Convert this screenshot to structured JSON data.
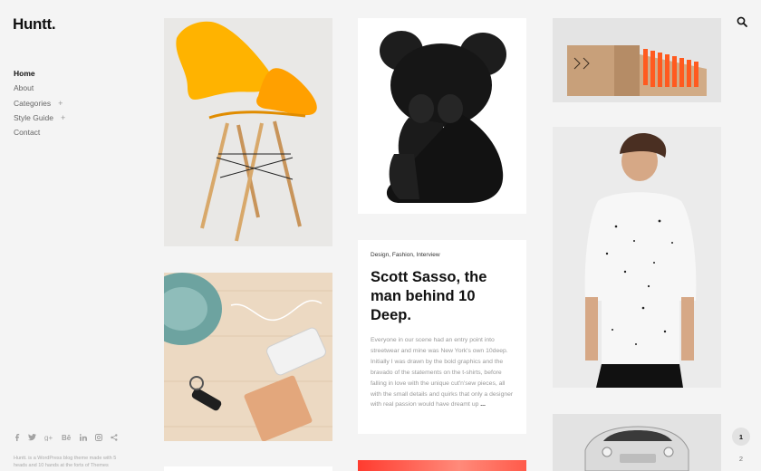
{
  "brand": {
    "logo": "Huntt."
  },
  "nav": {
    "items": [
      {
        "label": "Home"
      },
      {
        "label": "About"
      },
      {
        "label": "Categories",
        "expand": "+"
      },
      {
        "label": "Style Guide",
        "expand": "+"
      },
      {
        "label": "Contact"
      }
    ]
  },
  "social": [
    "f",
    "t",
    "g+",
    "Bē",
    "in",
    "ig",
    "share"
  ],
  "footer": {
    "text": "Huntt. is a WordPress blog theme made with 5 heads and 10 hands at the forts of Themes"
  },
  "post": {
    "categories": "Design, Fashion, Interview",
    "title": "Scott Sasso, the man behind 10 Deep.",
    "excerpt": "Everyone in our scene had an entry point into streetwear and mine was New York's own 10deep. Initially I was drawn by the bold graphics and the bravado of the statements on the t-shirts, before falling in love with the unique cut'n'sew pieces, all with the small details and quirks that only a designer with real passion would have dreamt up",
    "more": "..."
  },
  "pagination": {
    "current": "1",
    "next": "2"
  },
  "colors": {
    "background": "#f4f4f4",
    "card": "#ffffff",
    "chair": "#ffb300",
    "accent_red": "#ff3b2f"
  },
  "icons": {
    "search": "search-icon"
  }
}
